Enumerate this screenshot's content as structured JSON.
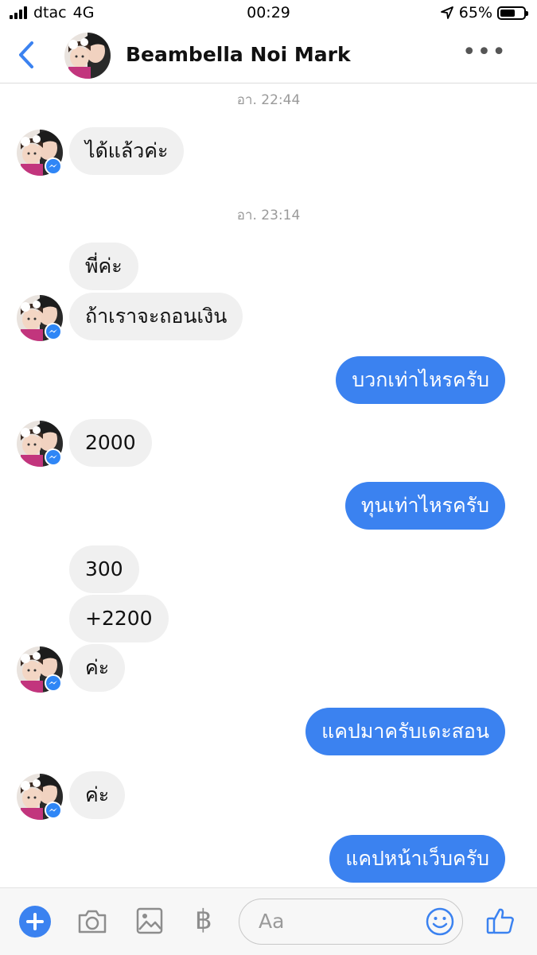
{
  "status_bar": {
    "carrier": "dtac",
    "network": "4G",
    "time": "00:29",
    "battery": "65%",
    "battery_level": 0.65
  },
  "header": {
    "contact_name": "Beambella Noi Mark"
  },
  "messages": {
    "ts1": "อา. 22:44",
    "m1": "ได้แล้วค่ะ",
    "ts2": "อา. 23:14",
    "m2": "พี่ค่ะ",
    "m3": "ถ้าเราจะถอนเงิน",
    "m4": "บวกเท่าไหรครับ",
    "m5": "2000",
    "m6": "ทุนเท่าไหรครับ",
    "m7": "300",
    "m8": "+2200",
    "m9": "ค่ะ",
    "m10": "แคปมาครับเดะสอน",
    "m11": "ค่ะ",
    "m12": "แคปหน้าเว็บครับ"
  },
  "composer": {
    "placeholder": "Aa",
    "currency_symbol": "฿"
  },
  "colors": {
    "accent": "#3b82f0",
    "incoming_bubble": "#f0f0f0",
    "timestamp": "#9a9a9a"
  },
  "icons": [
    "back-chevron-icon",
    "more-dots-icon",
    "messenger-badge-icon",
    "plus-icon",
    "camera-icon",
    "gallery-icon",
    "baht-icon",
    "emoji-icon",
    "thumbs-up-icon",
    "location-arrow-icon"
  ]
}
